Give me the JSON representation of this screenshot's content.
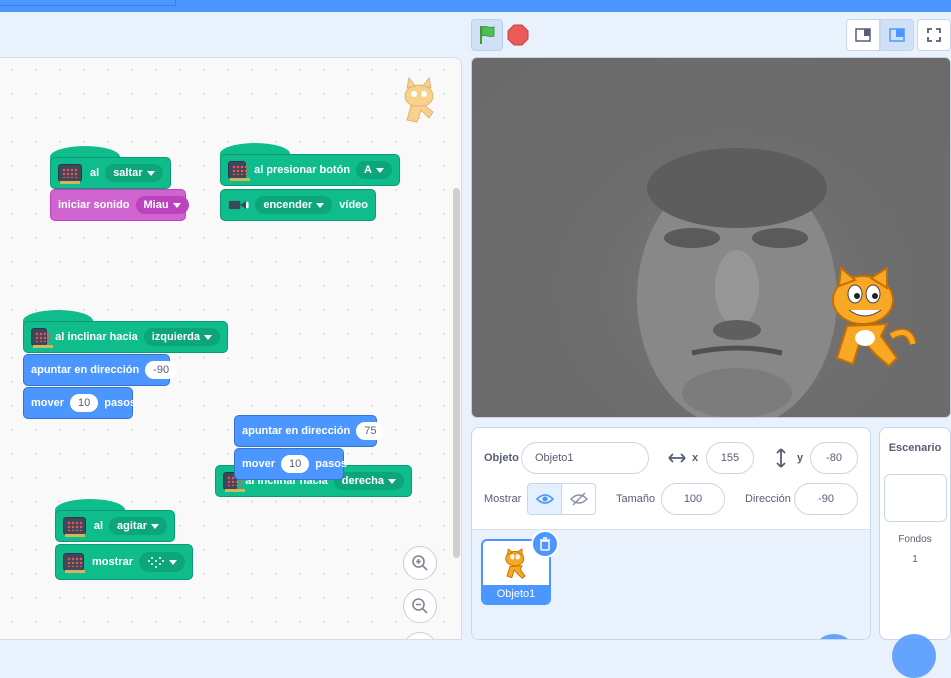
{
  "blocks": {
    "b1_event": "al",
    "b1_dd": "saltar",
    "b2_label": "iniciar sonido",
    "b2_dd": "Miau",
    "b3_event": "al presionar botón",
    "b3_dd": "A",
    "b4_dd": "encender",
    "b4_label": "vídeo",
    "b5_event": "al inclinar hacia",
    "b5_dd": "izquierda",
    "b6_label": "apuntar en dirección",
    "b6_val": "-90",
    "b7_label": "mover",
    "b7_val": "10",
    "b7_suffix": "pasos",
    "b8_label": "apuntar en dirección",
    "b8_val": "75",
    "b9_label": "mover",
    "b9_val": "10",
    "b9_suffix": "pasos",
    "b10_event": "al inclinar hacia",
    "b10_dd": "derecha",
    "b11_event": "al",
    "b11_dd": "agitar",
    "b12_label": "mostrar"
  },
  "sprite": {
    "label_objeto": "Objeto",
    "name": "Objeto1",
    "x_label": "x",
    "x": "155",
    "y_label": "y",
    "y": "-80",
    "show_label": "Mostrar",
    "size_label": "Tamaño",
    "size": "100",
    "dir_label": "Dirección",
    "dir": "-90",
    "thumb_name": "Objeto1"
  },
  "stage_panel": {
    "title": "Escenario",
    "backdrops_label": "Fondos",
    "backdrops_count": "1"
  },
  "colors": {
    "motion": "#4c97ff",
    "extension": "#0fbd8c",
    "sound": "#cf63cf"
  }
}
